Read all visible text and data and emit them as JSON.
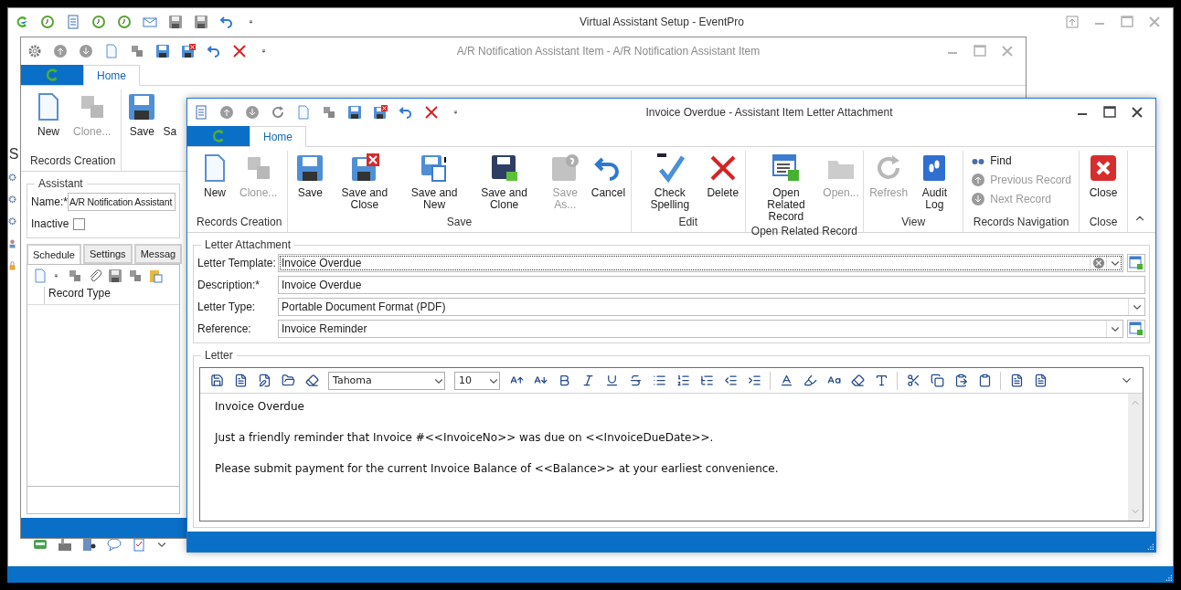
{
  "main_window": {
    "title": "Virtual Assistant Setup - EventPro",
    "side_label": "S"
  },
  "assistant_item_window": {
    "title": "A/R Notification Assistant Item - A/R Notification Assistant Item",
    "tabs": [
      {
        "label": "Home",
        "selected": true
      }
    ],
    "ribbon_buttons": [
      {
        "label": "New",
        "disabled": false
      },
      {
        "label": "Clone...",
        "disabled": true
      },
      {
        "label": "Save",
        "disabled": false
      },
      {
        "label": "Sa",
        "disabled": false
      }
    ],
    "ribbon_group": "Records Creation",
    "assistant": {
      "legend": "Assistant",
      "name_label": "Name:*",
      "name_value": "A/R Notification Assistant",
      "inactive_label": "Inactive",
      "inactive_checked": false
    },
    "tabs_lower": [
      {
        "label": "Schedule",
        "selected": true
      },
      {
        "label": "Settings",
        "selected": false
      },
      {
        "label": "Messag",
        "selected": false
      }
    ],
    "grid_columns": [
      "Record Type"
    ]
  },
  "letter_window": {
    "title": "Invoice Overdue - Assistant Item Letter Attachment",
    "tabs": [
      {
        "label": "Home",
        "selected": true
      }
    ],
    "ribbon_groups": [
      {
        "label": "Records Creation",
        "buttons": [
          {
            "label": "New",
            "disabled": false
          },
          {
            "label": "Clone...",
            "disabled": true
          }
        ]
      },
      {
        "label": "Save",
        "buttons": [
          {
            "label": "Save",
            "disabled": false
          },
          {
            "label": "Save and Close",
            "disabled": false
          },
          {
            "label": "Save and New",
            "disabled": false
          },
          {
            "label": "Save and Clone",
            "disabled": false
          },
          {
            "label": "Save As...",
            "disabled": true
          },
          {
            "label": "Cancel",
            "disabled": false
          }
        ]
      },
      {
        "label": "Edit",
        "buttons": [
          {
            "label": "Check Spelling",
            "disabled": false
          },
          {
            "label": "Delete",
            "disabled": false
          }
        ]
      },
      {
        "label": "Open Related Record",
        "buttons": [
          {
            "label": "Open Related Record",
            "disabled": false
          },
          {
            "label": "Open...",
            "disabled": true
          }
        ]
      },
      {
        "label": "View",
        "buttons": [
          {
            "label": "Refresh",
            "disabled": true
          },
          {
            "label": "Audit Log",
            "disabled": false
          }
        ]
      },
      {
        "label": "Records Navigation",
        "buttons": [
          {
            "label": "Find",
            "disabled": false,
            "kind": "small"
          },
          {
            "label": "Previous Record",
            "disabled": true,
            "kind": "small"
          },
          {
            "label": "Next Record",
            "disabled": true,
            "kind": "small"
          }
        ]
      },
      {
        "label": "Close",
        "buttons": [
          {
            "label": "Close",
            "disabled": false
          }
        ]
      }
    ],
    "attachment": {
      "legend": "Letter Attachment",
      "fields": [
        {
          "label": "Letter Template:",
          "value": "Invoice Overdue",
          "kind": "lookup",
          "focused": true
        },
        {
          "label": "Description:*",
          "value": "Invoice Overdue",
          "kind": "text",
          "focused": false
        },
        {
          "label": "Letter Type:",
          "value": "Portable Document Format (PDF)",
          "kind": "dropdown",
          "focused": false
        },
        {
          "label": "Reference:",
          "value": "Invoice Reminder",
          "kind": "reference",
          "focused": false
        }
      ]
    },
    "letter": {
      "legend": "Letter",
      "font": "Tahoma",
      "size": "10",
      "paragraphs": [
        "Invoice Overdue",
        "Just a friendly reminder that Invoice #<<InvoiceNo>> was due on <<InvoiceDueDate>>.",
        "Please submit payment for the current Invoice Balance of <<Balance>> at your earliest convenience."
      ]
    }
  }
}
